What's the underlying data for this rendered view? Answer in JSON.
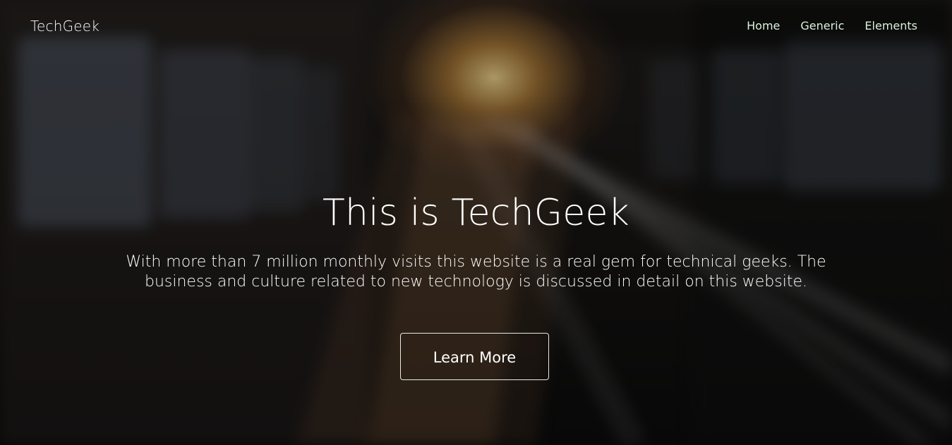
{
  "header": {
    "brand": "TechGeek",
    "nav": [
      {
        "label": "Home"
      },
      {
        "label": "Generic"
      },
      {
        "label": "Elements"
      }
    ]
  },
  "hero": {
    "title": "This is TechGeek",
    "description": "With more than 7 million monthly visits this website is a real gem for technical geeks. The business and culture related to new technology is discussed in detail on this website.",
    "button_label": "Learn More"
  },
  "colors": {
    "text": "#ffffff",
    "nav_text": "#d9f2d9",
    "overlay": "#000000",
    "accent_glow": "#ffd98a"
  },
  "icons": {
    "background": "train-station-blurred-background"
  }
}
